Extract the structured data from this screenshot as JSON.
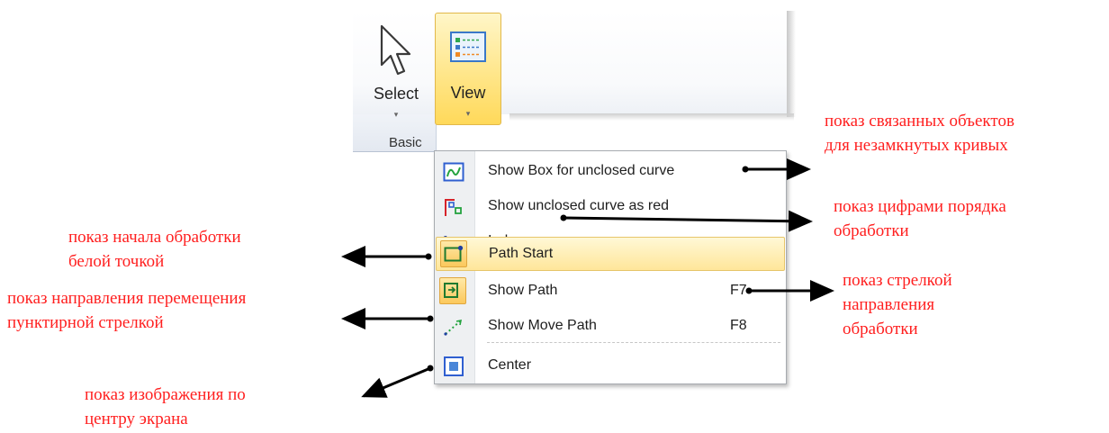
{
  "ribbon": {
    "select_label": "Select",
    "view_label": "View",
    "group_label": "Basic",
    "caret": "▾"
  },
  "menu": {
    "items": [
      {
        "label": "Show Box for unclosed curve",
        "shortcut": "",
        "icon": "box-curve-icon",
        "highlighted": false
      },
      {
        "label": "Show unclosed curve as red",
        "shortcut": "",
        "icon": "red-curve-icon",
        "highlighted": false
      },
      {
        "label": "Index",
        "shortcut": "",
        "icon": "index-numbers-icon",
        "highlighted": false
      },
      {
        "label": "Path Start",
        "shortcut": "",
        "icon": "path-start-icon",
        "highlighted": true
      },
      {
        "label": "Show Path",
        "shortcut": "F7",
        "icon": "show-path-icon",
        "highlighted": false
      },
      {
        "label": "Show Move Path",
        "shortcut": "F8",
        "icon": "move-path-icon",
        "highlighted": false
      },
      {
        "label": "Center",
        "shortcut": "",
        "icon": "center-icon",
        "highlighted": false
      }
    ]
  },
  "annotations": {
    "box_unclosed": [
      "показ связанных объектов",
      "для незамкнутых кривых"
    ],
    "index": [
      "показ цифрами порядка",
      "обработки"
    ],
    "path_start": [
      "показ начала обработки",
      "белой точкой"
    ],
    "move_path": [
      "показ направления перемещения",
      "пунктирной стрелкой"
    ],
    "show_path": [
      "показ стрелкой",
      "направления",
      "обработки"
    ],
    "center": [
      "показ изображения по",
      "центру экрана"
    ]
  },
  "colors": {
    "annotation": "#ff1f1f",
    "highlight": "#ffe69a",
    "menu_border": "#a7abb0"
  }
}
